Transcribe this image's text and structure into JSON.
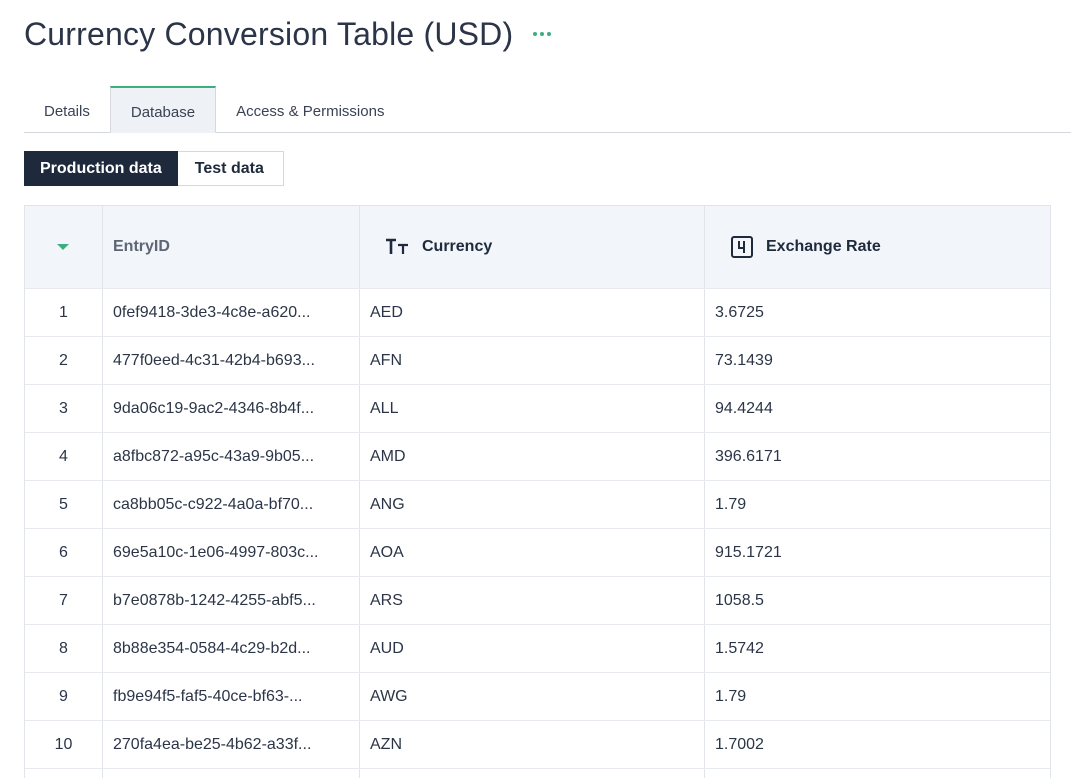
{
  "page": {
    "title": "Currency Conversion Table (USD)",
    "more_icon": "more-horizontal-icon"
  },
  "colors": {
    "accent": "#3dae7e",
    "dark": "#1e2a3c",
    "header_bg": "#f2f6fa",
    "tab_active_bg": "#eef2f6"
  },
  "tabs": [
    {
      "label": "Details",
      "active": false
    },
    {
      "label": "Database",
      "active": true
    },
    {
      "label": "Access & Permissions",
      "active": false
    }
  ],
  "data_toggle": {
    "production_label": "Production data",
    "test_label": "Test data",
    "selected": "Production data"
  },
  "table": {
    "columns": {
      "entry_id": "EntryID",
      "currency": "Currency",
      "currency_icon": "text-type-icon",
      "exchange_rate": "Exchange Rate",
      "exchange_rate_icon": "number-type-icon",
      "sort_icon": "sort-caret-down-icon"
    },
    "rows": [
      {
        "num": "1",
        "id": "0fef9418-3de3-4c8e-a620...",
        "currency": "AED",
        "rate": "3.6725"
      },
      {
        "num": "2",
        "id": "477f0eed-4c31-42b4-b693...",
        "currency": "AFN",
        "rate": "73.1439"
      },
      {
        "num": "3",
        "id": "9da06c19-9ac2-4346-8b4f...",
        "currency": "ALL",
        "rate": "94.4244"
      },
      {
        "num": "4",
        "id": "a8fbc872-a95c-43a9-9b05...",
        "currency": "AMD",
        "rate": "396.6171"
      },
      {
        "num": "5",
        "id": "ca8bb05c-c922-4a0a-bf70...",
        "currency": "ANG",
        "rate": "1.79"
      },
      {
        "num": "6",
        "id": "69e5a10c-1e06-4997-803c...",
        "currency": "AOA",
        "rate": "915.1721"
      },
      {
        "num": "7",
        "id": "b7e0878b-1242-4255-abf5...",
        "currency": "ARS",
        "rate": "1058.5"
      },
      {
        "num": "8",
        "id": "8b88e354-0584-4c29-b2d...",
        "currency": "AUD",
        "rate": "1.5742"
      },
      {
        "num": "9",
        "id": "fb9e94f5-faf5-40ce-bf63-...",
        "currency": "AWG",
        "rate": "1.79"
      },
      {
        "num": "10",
        "id": "270fa4ea-be25-4b62-a33f...",
        "currency": "AZN",
        "rate": "1.7002"
      }
    ]
  }
}
